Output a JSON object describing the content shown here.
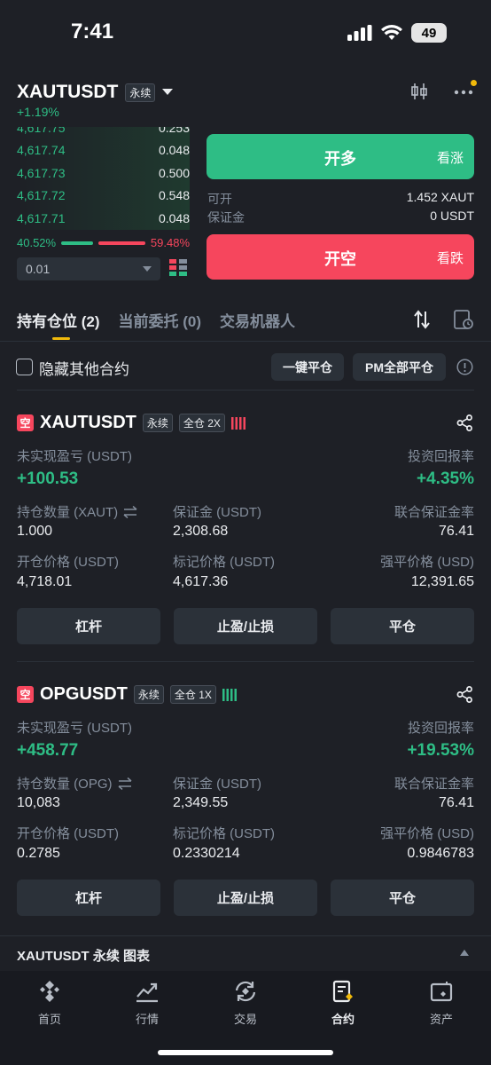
{
  "status": {
    "time": "7:41",
    "battery": "49"
  },
  "header": {
    "symbol": "XAUTUSDT",
    "tag": "永续",
    "change": "+1.19%"
  },
  "orderbook": {
    "rows": [
      {
        "price": "4,617.75",
        "qty": "0.253"
      },
      {
        "price": "4,617.74",
        "qty": "0.048"
      },
      {
        "price": "4,617.73",
        "qty": "0.500"
      },
      {
        "price": "4,617.72",
        "qty": "0.548"
      },
      {
        "price": "4,617.71",
        "qty": "0.048"
      }
    ],
    "buy_ratio": "40.52%",
    "sell_ratio": "59.48%",
    "precision": "0.01"
  },
  "trade": {
    "long_label": "开多",
    "long_sub": "看涨",
    "short_label": "开空",
    "short_sub": "看跌",
    "available_label": "可开",
    "available_value": "1.452 XAUT",
    "margin_label": "保证金",
    "margin_value": "0 USDT"
  },
  "tabs": [
    {
      "label": "持有仓位 (2)"
    },
    {
      "label": "当前委托 (0)"
    },
    {
      "label": "交易机器人"
    }
  ],
  "controls": {
    "hide_label": "隐藏其他合约",
    "close_all_label": "一键平仓",
    "pm_close_label": "PM全部平仓"
  },
  "positions": [
    {
      "side": "空",
      "symbol": "XAUTUSDT",
      "tag": "永续",
      "mode": "全仓 2X",
      "pnl_label": "未实现盈亏 (USDT)",
      "pnl_value": "+100.53",
      "roe_label": "投资回报率",
      "roe_value": "+4.35%",
      "size_label": "持仓数量 (XAUT)",
      "size_value": "1.000",
      "margin_label": "保证金 (USDT)",
      "margin_value": "2,308.68",
      "ratio_label": "联合保证金率",
      "ratio_value": "76.41",
      "entry_label": "开仓价格 (USDT)",
      "entry_value": "4,718.01",
      "mark_label": "标记价格 (USDT)",
      "mark_value": "4,617.36",
      "liq_label": "强平价格 (USD)",
      "liq_value": "12,391.65",
      "btn_leverage": "杠杆",
      "btn_tpsl": "止盈/止损",
      "btn_close": "平仓",
      "adl_color": "#f6465d"
    },
    {
      "side": "空",
      "symbol": "OPGUSDT",
      "tag": "永续",
      "mode": "全仓 1X",
      "pnl_label": "未实现盈亏 (USDT)",
      "pnl_value": "+458.77",
      "roe_label": "投资回报率",
      "roe_value": "+19.53%",
      "size_label": "持仓数量 (OPG)",
      "size_value": "10,083",
      "margin_label": "保证金 (USDT)",
      "margin_value": "2,349.55",
      "ratio_label": "联合保证金率",
      "ratio_value": "76.41",
      "entry_label": "开仓价格 (USDT)",
      "entry_value": "0.2785",
      "mark_label": "标记价格 (USDT)",
      "mark_value": "0.2330214",
      "liq_label": "强平价格 (USD)",
      "liq_value": "0.9846783",
      "btn_leverage": "杠杆",
      "btn_tpsl": "止盈/止损",
      "btn_close": "平仓",
      "adl_color": "#2ebd85"
    }
  ],
  "chart_bar": {
    "label": "XAUTUSDT 永续 图表"
  },
  "nav": [
    {
      "label": "首页",
      "icon": "home-icon"
    },
    {
      "label": "行情",
      "icon": "markets-icon"
    },
    {
      "label": "交易",
      "icon": "trade-icon"
    },
    {
      "label": "合约",
      "icon": "futures-icon"
    },
    {
      "label": "资产",
      "icon": "assets-icon"
    }
  ],
  "colors": {
    "accent": "#f0b90b",
    "green": "#2ebd85",
    "red": "#f6465d",
    "bg": "#1e2026"
  }
}
